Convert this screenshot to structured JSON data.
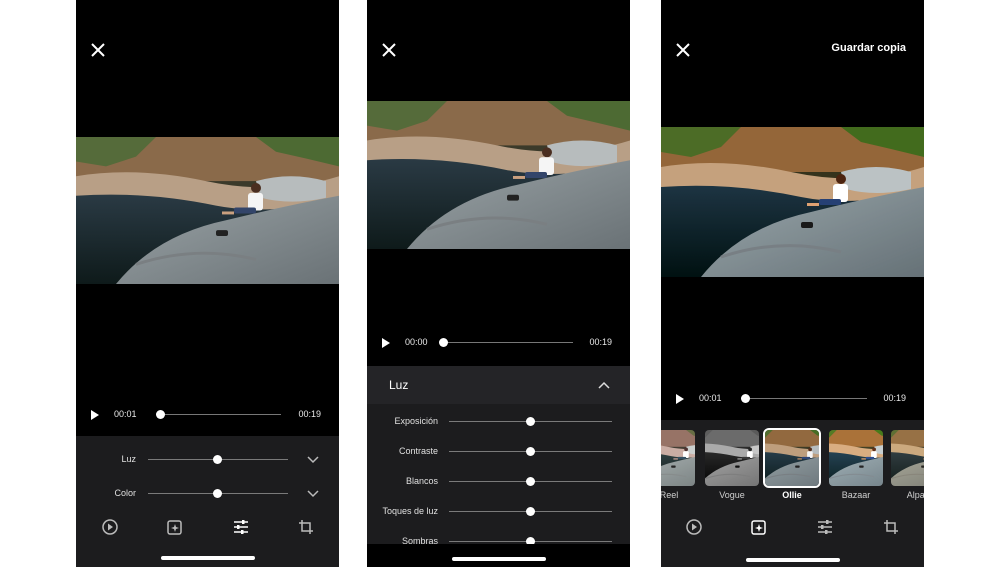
{
  "screens": [
    {
      "player": {
        "current_time": "00:01",
        "duration": "00:19",
        "progress": 0.05
      },
      "adjust_rows": [
        {
          "label": "Luz",
          "value": 0.5
        },
        {
          "label": "Color",
          "value": 0.5
        }
      ],
      "nav_icons": [
        "play-circle-icon",
        "enhance-icon",
        "tune-icon",
        "crop-rotate-icon"
      ],
      "active_nav": "tune-icon"
    },
    {
      "player": {
        "current_time": "00:00",
        "duration": "00:19",
        "progress": 0.0
      },
      "section_title": "Luz",
      "sliders": [
        {
          "label": "Exposición",
          "value": 0.5
        },
        {
          "label": "Contraste",
          "value": 0.5
        },
        {
          "label": "Blancos",
          "value": 0.5
        },
        {
          "label": "Toques de luz",
          "value": 0.5
        },
        {
          "label": "Sombras",
          "value": 0.5
        }
      ]
    },
    {
      "save_label": "Guardar copia",
      "player": {
        "current_time": "00:01",
        "duration": "00:19",
        "progress": 0.05
      },
      "filters": [
        {
          "label": "Reel"
        },
        {
          "label": "Vogue"
        },
        {
          "label": "Ollie",
          "selected": true
        },
        {
          "label": "Bazaar"
        },
        {
          "label": "Alpac"
        }
      ],
      "active_nav": "enhance-icon"
    }
  ]
}
